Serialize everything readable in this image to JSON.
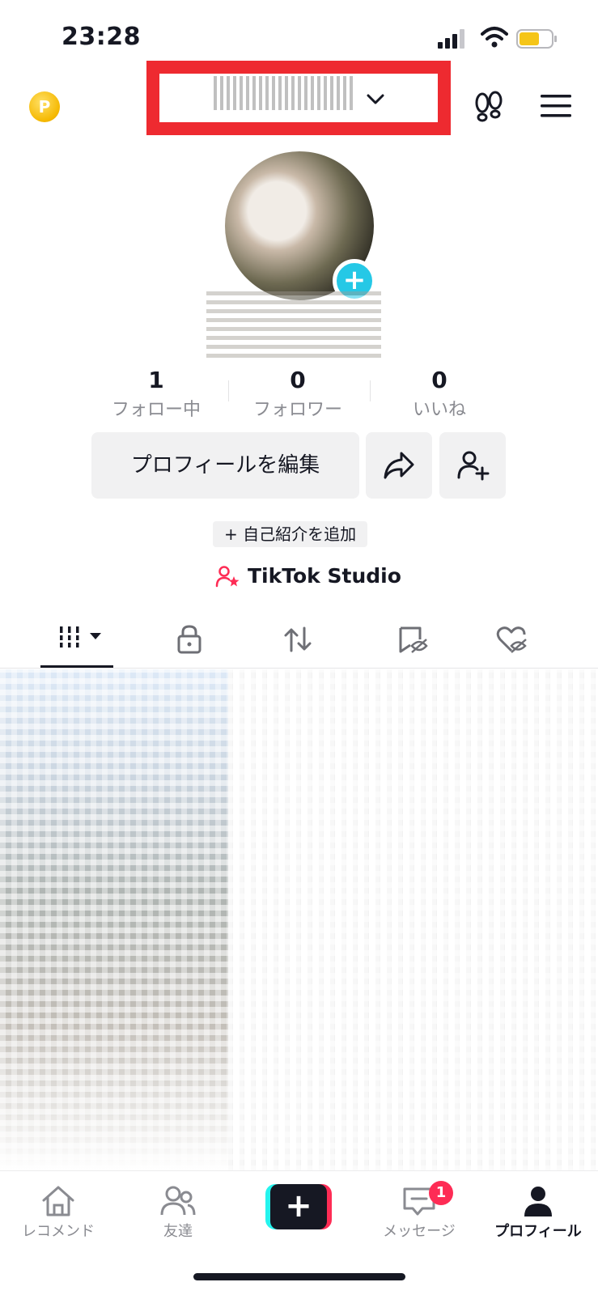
{
  "status_bar": {
    "time": "23:28",
    "battery_color": "#f5c518"
  },
  "header": {
    "coin_glyph": "P",
    "username_chevron_icon": "chevron-down-icon",
    "footprint_icon": "footprint-icon",
    "menu_icon": "hamburger-menu-icon"
  },
  "avatar": {
    "add_glyph": "+"
  },
  "stats": [
    {
      "value": "1",
      "label": "フォロー中"
    },
    {
      "value": "0",
      "label": "フォロワー"
    },
    {
      "value": "0",
      "label": "いいね"
    }
  ],
  "actions": {
    "edit_label": "プロフィールを編集"
  },
  "bio": {
    "add_label": "+ 自己紹介を追加"
  },
  "studio": {
    "label": "TikTok Studio",
    "icon_color": "#fe2c55"
  },
  "tabs": [
    {
      "icon": "grid-videos-icon"
    },
    {
      "icon": "lock-icon"
    },
    {
      "icon": "repost-icon"
    },
    {
      "icon": "saved-hidden-icon"
    },
    {
      "icon": "liked-hidden-icon"
    }
  ],
  "bottom_nav": {
    "items": [
      {
        "label": "レコメンド",
        "icon": "home-icon"
      },
      {
        "label": "友達",
        "icon": "friends-icon"
      },
      {
        "label": "",
        "icon": "create-plus-icon"
      },
      {
        "label": "メッセージ",
        "icon": "message-icon",
        "badge": "1"
      },
      {
        "label": "プロフィール",
        "icon": "profile-icon"
      }
    ],
    "create_glyph": "+"
  },
  "colors": {
    "accent_cyan": "#25c8e6",
    "accent_red": "#fe2c55",
    "highlight_box": "#ee2a30"
  }
}
